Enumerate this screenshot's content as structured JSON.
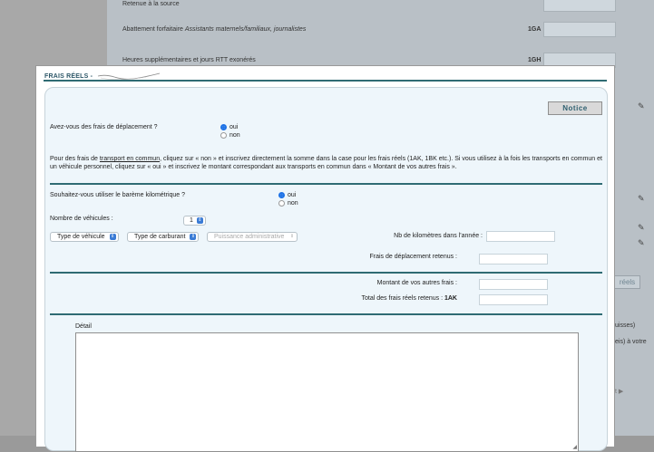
{
  "background": {
    "rows": [
      {
        "label": "Retenue à la source",
        "code": ""
      },
      {
        "label_prefix": "Abattement forfaitaire ",
        "label_italic": "Assistants maternels/familiaux, journalistes",
        "code": "1GA"
      },
      {
        "label": "Heures supplémentaires et jours RTT exonérés",
        "code": "1GH"
      }
    ],
    "button_reels": "réels",
    "side_text_1": "uisses)",
    "side_text_2": "eis) à votre",
    "side_text_3": "t ▶"
  },
  "modal": {
    "title": "FRAIS RÉELS -",
    "notice_label": "Notice",
    "q_deplacement": "Avez-vous des frais de déplacement ?",
    "yes": "oui",
    "no": "non",
    "para_prefix": "Pour des frais de ",
    "para_link": "transport en commun",
    "para_rest": ", cliquez sur « non » et inscrivez directement la somme dans la case pour les frais réels (1AK, 1BK etc.). Si vous utilisez à la fois les transports en commun et un véhicule personnel, cliquez sur « oui » et inscrivez le montant correspondant aux transports en commun dans « Montant de vos autres frais ».",
    "q_bareme": "Souhaitez-vous utiliser le barème kilométrique ?",
    "nb_vehicules_label": "Nombre de véhicules :",
    "nb_vehicules_value": "1",
    "type_vehicule": "Type de véhicule",
    "type_carburant": "Type de carburant",
    "puissance": "Puissance administrative",
    "nb_km_label": "Nb de kilomètres dans l'année :",
    "frais_retenus_label": "Frais de déplacement retenus :",
    "autres_frais_label": "Montant de vos autres frais :",
    "total_label": "Total des frais réels retenus :",
    "total_code": "1AK",
    "detail_label": "Détail"
  }
}
